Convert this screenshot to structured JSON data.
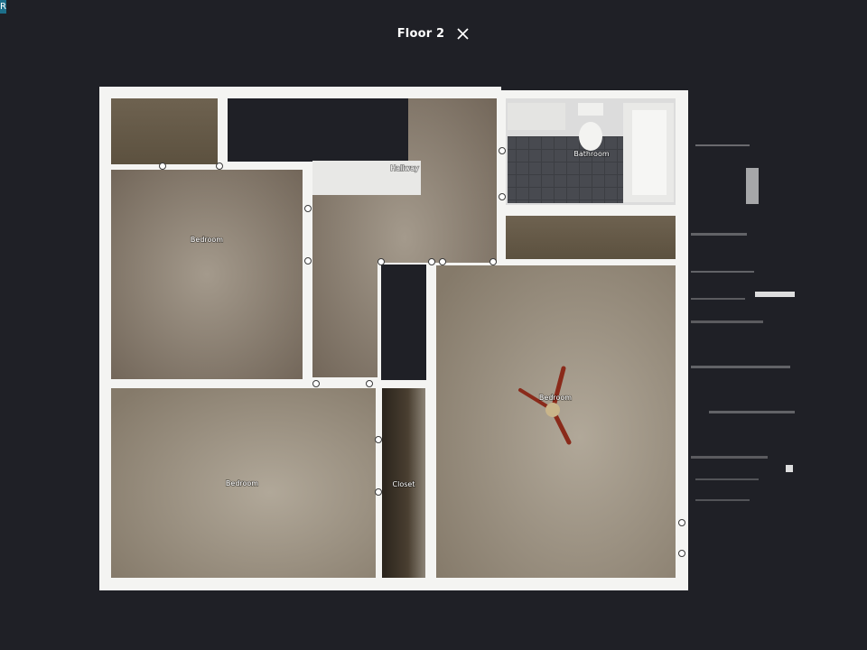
{
  "header": {
    "floor_title": "Floor 2",
    "close_icon": "close-icon"
  },
  "corner_badge": "R",
  "rooms": {
    "hallway": "Hallway",
    "bathroom": "Bathroom",
    "bedroom_top_left": "Bedroom",
    "bedroom_bottom_left": "Bedroom",
    "closet": "Closet",
    "bedroom_right": "Bedroom"
  },
  "colors": {
    "background": "#1f2026",
    "wall": "#f4f4f2",
    "carpet": "#8c8070",
    "tile": "#3a3c40"
  }
}
